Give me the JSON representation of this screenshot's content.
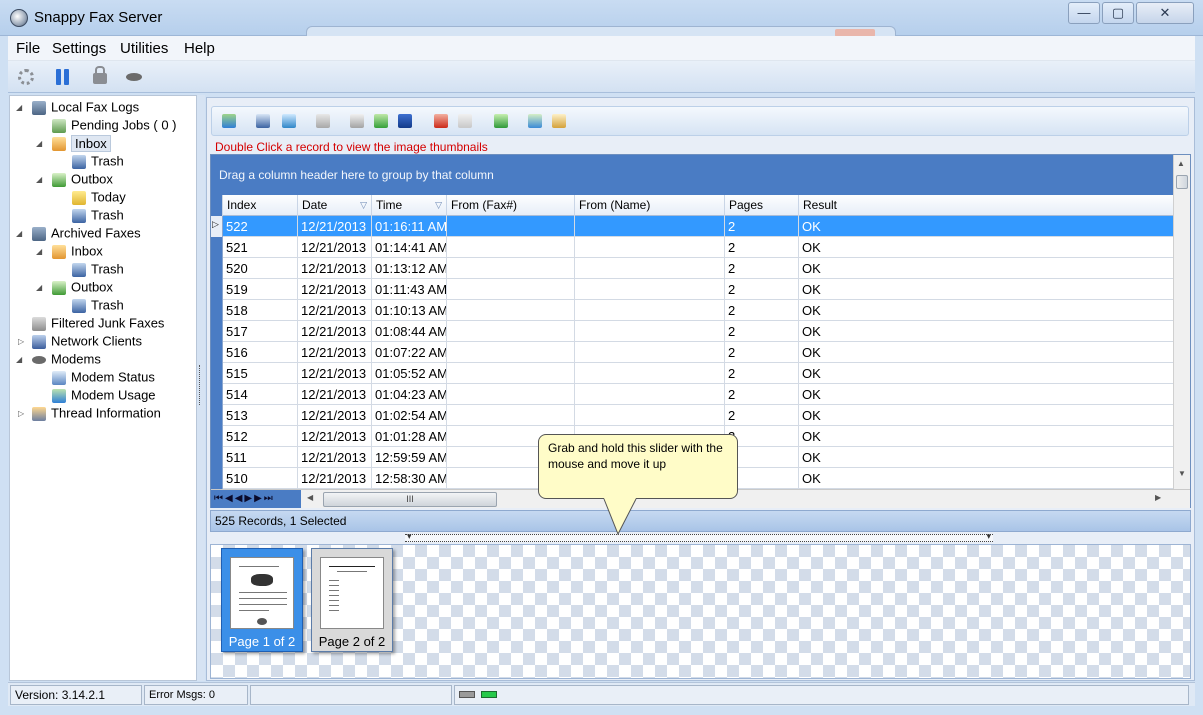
{
  "window": {
    "title": "Snappy Fax Server",
    "min_glyph": "—",
    "max_glyph": "▢",
    "close_glyph": "✕"
  },
  "menu": {
    "file": "File",
    "settings": "Settings",
    "utilities": "Utilities",
    "help": "Help"
  },
  "toolbar_icons": [
    "gear-icon",
    "pause-icon",
    "lock-icon",
    "modem-icon"
  ],
  "tree": {
    "local_fax_logs": "Local Fax Logs",
    "pending_jobs": "Pending Jobs ( 0 )",
    "inbox": "Inbox",
    "trash_1": "Trash",
    "outbox": "Outbox",
    "today": "Today",
    "trash_2": "Trash",
    "archived_faxes": "Archived Faxes",
    "archived_inbox": "Inbox",
    "trash_3": "Trash",
    "archived_outbox": "Outbox",
    "trash_4": "Trash",
    "filtered_junk": "Filtered Junk Faxes",
    "network_clients": "Network Clients",
    "modems": "Modems",
    "modem_status": "Modem  Status",
    "modem_usage": "Modem  Usage",
    "thread_info": "Thread Information"
  },
  "hint": "Double Click a record to view the image thumbnails",
  "grid": {
    "group_prompt": "Drag a column header here to group by that column",
    "columns": [
      "Index",
      "Date",
      "Time",
      "From (Fax#)",
      "From (Name)",
      "Pages",
      "Result"
    ],
    "rows": [
      [
        "522",
        "12/21/2013",
        "01:16:11 AM",
        "",
        "",
        "2",
        "OK"
      ],
      [
        "521",
        "12/21/2013",
        "01:14:41 AM",
        "",
        "",
        "2",
        "OK"
      ],
      [
        "520",
        "12/21/2013",
        "01:13:12 AM",
        "",
        "",
        "2",
        "OK"
      ],
      [
        "519",
        "12/21/2013",
        "01:11:43 AM",
        "",
        "",
        "2",
        "OK"
      ],
      [
        "518",
        "12/21/2013",
        "01:10:13 AM",
        "",
        "",
        "2",
        "OK"
      ],
      [
        "517",
        "12/21/2013",
        "01:08:44 AM",
        "",
        "",
        "2",
        "OK"
      ],
      [
        "516",
        "12/21/2013",
        "01:07:22 AM",
        "",
        "",
        "2",
        "OK"
      ],
      [
        "515",
        "12/21/2013",
        "01:05:52 AM",
        "",
        "",
        "2",
        "OK"
      ],
      [
        "514",
        "12/21/2013",
        "01:04:23 AM",
        "",
        "",
        "2",
        "OK"
      ],
      [
        "513",
        "12/21/2013",
        "01:02:54 AM",
        "",
        "",
        "2",
        "OK"
      ],
      [
        "512",
        "12/21/2013",
        "01:01:28 AM",
        "",
        "",
        "2",
        "OK"
      ],
      [
        "511",
        "12/21/2013",
        "12:59:59 AM",
        "",
        "",
        "2",
        "OK"
      ],
      [
        "510",
        "12/21/2013",
        "12:58:30 AM",
        "",
        "",
        "2",
        "OK"
      ]
    ],
    "selected_row": 0,
    "nav_glyphs": "⏮◀◀▶▶⏭",
    "hscroll_grip": "III"
  },
  "records_status": "525 Records, 1 Selected",
  "thumbnails": [
    {
      "caption": "Page 1 of 2"
    },
    {
      "caption": "Page 2 of 2"
    }
  ],
  "callout": "Grab and hold this slider with the mouse and move it up",
  "statusbar": {
    "version": "Version: 3.14.2.1",
    "errors": "Error Msgs: 0"
  },
  "colors": {
    "accent": "#4a7cc4",
    "selection": "#3399ff",
    "hint": "#d40000",
    "callout": "#fffcc8"
  }
}
